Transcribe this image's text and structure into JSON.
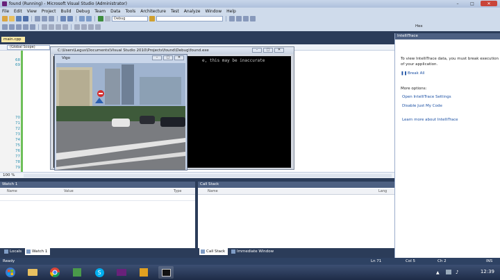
{
  "window": {
    "title": "found (Running) - Microsoft Visual Studio (Administrator)"
  },
  "menu": [
    "File",
    "Edit",
    "View",
    "Project",
    "Build",
    "Debug",
    "Team",
    "Data",
    "Tools",
    "Architecture",
    "Test",
    "Analyze",
    "Window",
    "Help"
  ],
  "toolbar": {
    "config": "Debug",
    "hex_label": "Hex"
  },
  "editor": {
    "doc_tab": "main.cpp",
    "scope": "(Global Scope)",
    "line_numbers": [
      "68",
      "69",
      "",
      "",
      "",
      "",
      "",
      "",
      "",
      "",
      "",
      "",
      "70",
      "71",
      "72",
      "73",
      "74",
      "75",
      "76",
      "77",
      "78",
      "79"
    ],
    "line_numbers_top": [
      "68",
      "69"
    ],
    "line_numbers_bottom": [
      "70",
      "71",
      "72",
      "73",
      "74",
      "75",
      "76",
      "77",
      "78",
      "79"
    ],
    "zoom": "100 %"
  },
  "console": {
    "title": "C:\\Users\\Legus\\Documents\\Visual Studio 2010\\Projects\\found\\Debug\\found.exe",
    "output": "e, this may be inaccurate",
    "controls": [
      "–",
      "□",
      "✕"
    ]
  },
  "video_window": {
    "title": "Vigo",
    "controls": [
      "–",
      "□",
      "✕"
    ]
  },
  "intellitrace": {
    "title": "IntelliTrace",
    "info_line1": "To view IntelliTrace data, you must break execution",
    "info_line2": "of your application.",
    "break_all": "Break All",
    "more_options": "More options:",
    "open_settings": "Open IntelliTrace Settings",
    "disable_jmc": "Disable Just My Code",
    "learn_more": "Learn more about IntelliTrace"
  },
  "watch": {
    "title": "Watch 1",
    "col_name": "Name",
    "col_value": "Value",
    "col_type": "Type"
  },
  "callstack": {
    "title": "Call Stack",
    "col_name": "Name",
    "col_lang": "Lang"
  },
  "bottom_tabs_left": [
    "Locals",
    "Watch 1"
  ],
  "bottom_tabs_right": [
    "Call Stack",
    "Immediate Window"
  ],
  "status": {
    "ready": "Ready",
    "line": "Ln 71",
    "col": "Col 5",
    "ch": "Ch 2",
    "mode": "INS"
  },
  "clock": "12:39"
}
